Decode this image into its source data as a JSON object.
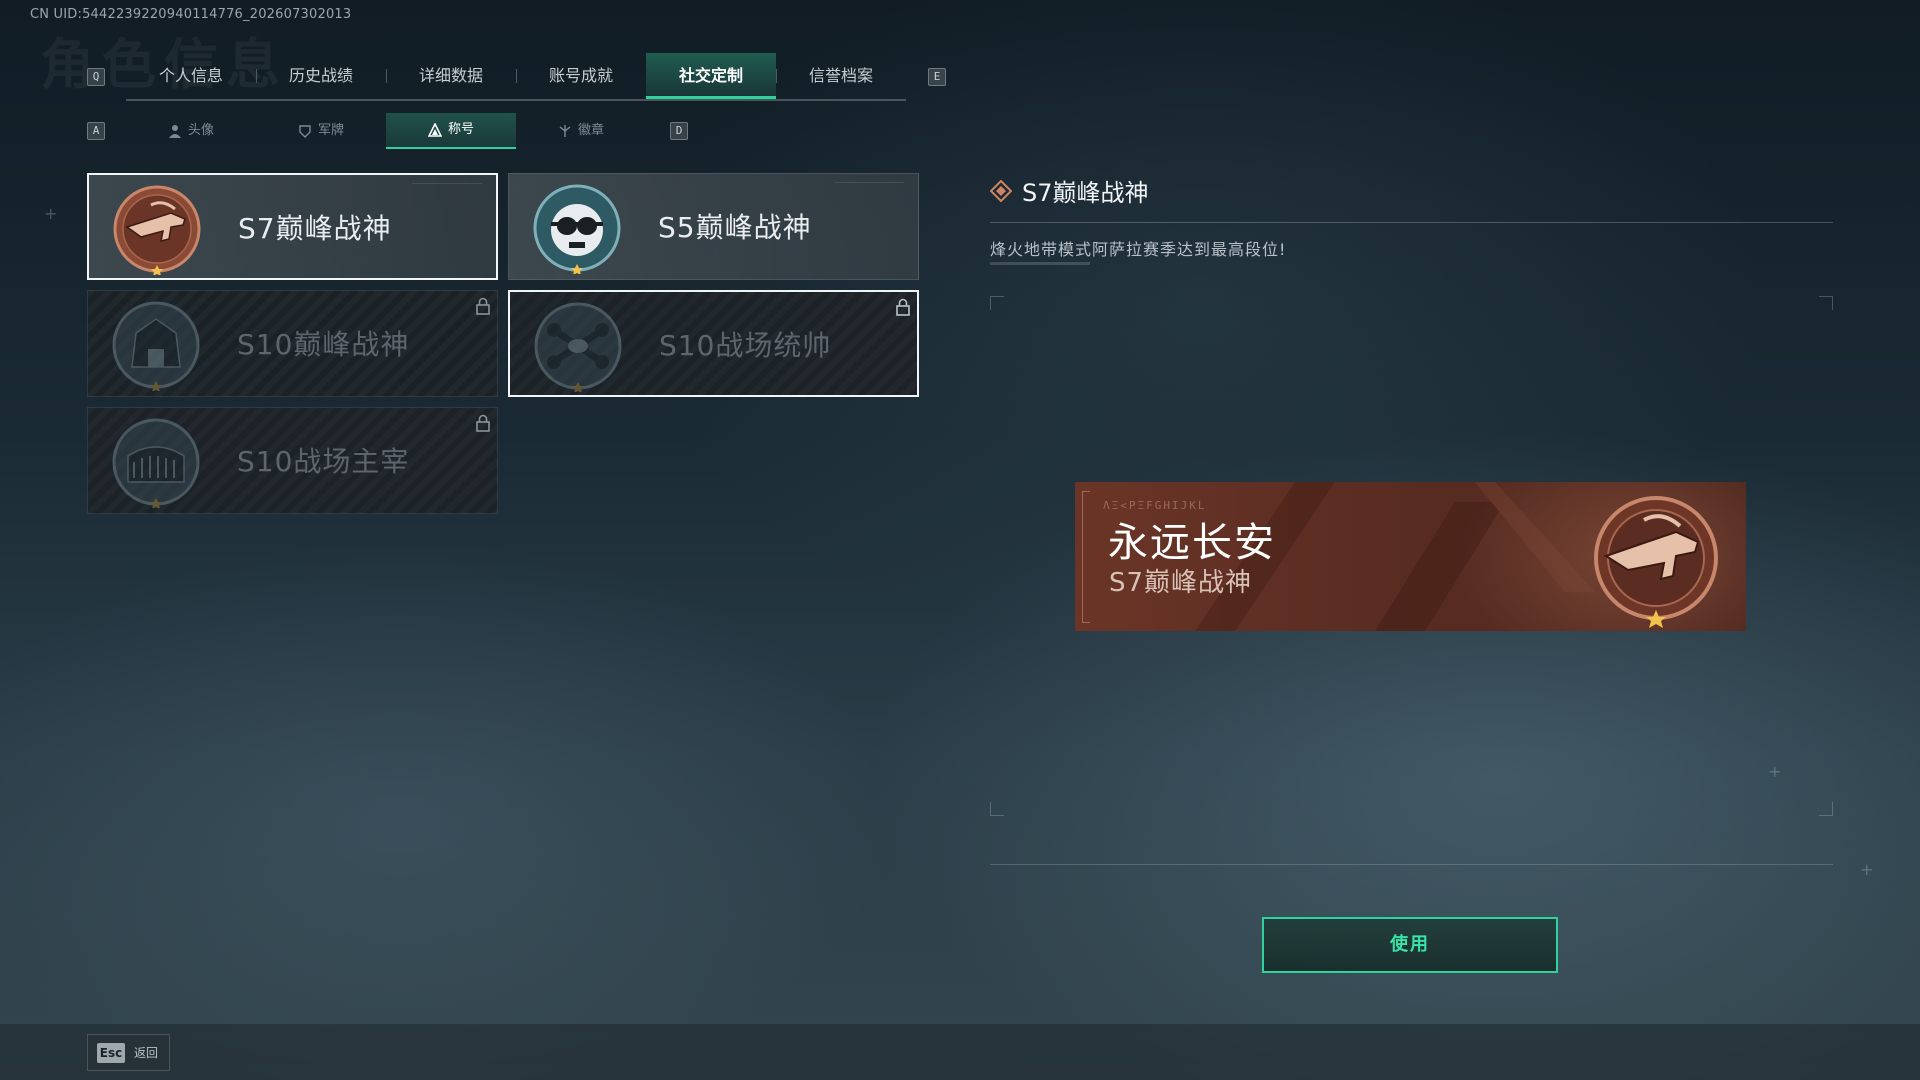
{
  "header": {
    "uid": "CN UID:5442239220940114776_202607302013",
    "ghost_title": "角色信息"
  },
  "tabs": {
    "key_prev": "Q",
    "key_next": "E",
    "items": [
      "个人信息",
      "历史战绩",
      "详细数据",
      "账号成就",
      "社交定制",
      "信誉档案"
    ],
    "active": "社交定制"
  },
  "subtabs": {
    "key_prev": "A",
    "key_next": "D",
    "items": [
      {
        "label": "头像",
        "icon": "person-icon"
      },
      {
        "label": "军牌",
        "icon": "shield-tag-icon"
      },
      {
        "label": "称号",
        "icon": "triangle-icon"
      },
      {
        "label": "徽章",
        "icon": "emblem-icon"
      }
    ],
    "active": "称号"
  },
  "titles": [
    {
      "name": "S7巅峰战神",
      "badge": "rifle-badge-icon",
      "locked": false,
      "selected": true
    },
    {
      "name": "S5巅峰战神",
      "badge": "skull-goggles-badge-icon",
      "locked": false,
      "selected": false
    },
    {
      "name": "S10巅峰战神",
      "badge": "pagoda-badge-icon",
      "locked": true,
      "selected": false
    },
    {
      "name": "S10战场统帅",
      "badge": "drone-badge-icon",
      "locked": true,
      "selected": true
    },
    {
      "name": "S10战场主宰",
      "badge": "colosseum-badge-icon",
      "locked": true,
      "selected": false
    }
  ],
  "detail": {
    "title": "S7巅峰战神",
    "description": "烽火地带模式阿萨拉赛季达到最高段位!"
  },
  "banner": {
    "code": "ΛΞ<PΞFGHIJKL",
    "player_name": "永远长安",
    "title": "S7巅峰战神"
  },
  "actions": {
    "use_label": "使用",
    "esc_key": "Esc",
    "back_label": "返回"
  },
  "colors": {
    "accent": "#2fd29a",
    "banner_bg": "#5a2c22",
    "badge_copper": "#b9745a",
    "badge_teal": "#2e5a64"
  }
}
